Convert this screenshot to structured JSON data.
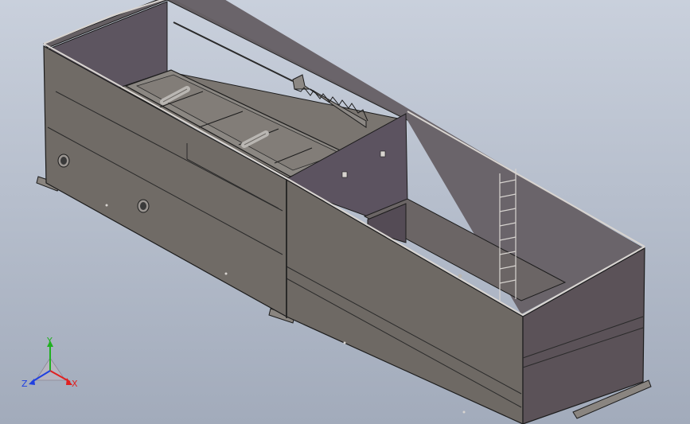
{
  "view": {
    "background_top": "#c9d0dc",
    "background_bottom": "#a2abbb",
    "model_color": "#6f6b66",
    "model_dark_color": "#5b5258",
    "inner_wall_color": "#5f5660",
    "edge_color": "#1c1c1c"
  },
  "triad": {
    "x_label": "X",
    "y_label": "Y",
    "z_label": "Z",
    "x_color": "#e02020",
    "y_color": "#20b020",
    "z_color": "#2040e0"
  }
}
